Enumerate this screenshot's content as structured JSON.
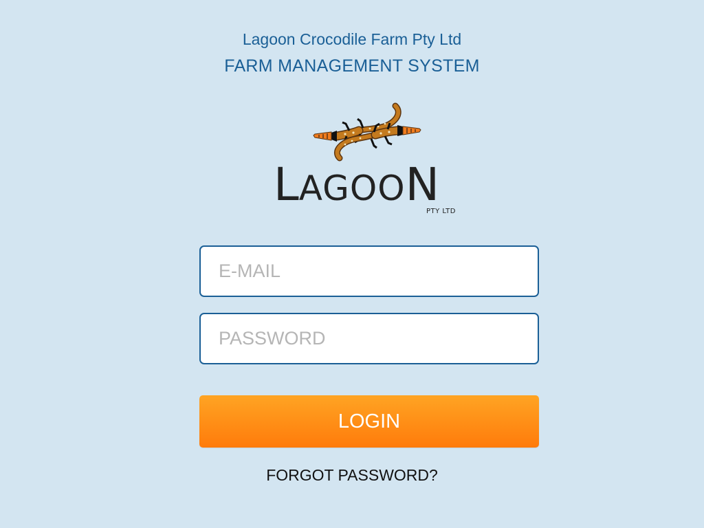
{
  "header": {
    "company": "Lagoon Crocodile Farm Pty Ltd",
    "system": "FARM MANAGEMENT SYSTEM"
  },
  "logo": {
    "word_first": "L",
    "word_rest": "AGOO",
    "word_last": "N",
    "subtext": "PTY LTD",
    "colors": {
      "body": "#c47a1e",
      "body_outline": "#5a3410",
      "head": "#f07c1e",
      "dots": "#f3e3b8",
      "stripes": "#111111"
    }
  },
  "form": {
    "email_placeholder": "E-MAIL",
    "password_placeholder": "PASSWORD",
    "login_label": "LOGIN",
    "forgot_label": "FORGOT PASSWORD?"
  },
  "colors": {
    "background": "#d3e5f1",
    "accent": "#1a5f96",
    "button_top": "#ffa423",
    "button_bottom": "#ff7b0b"
  }
}
